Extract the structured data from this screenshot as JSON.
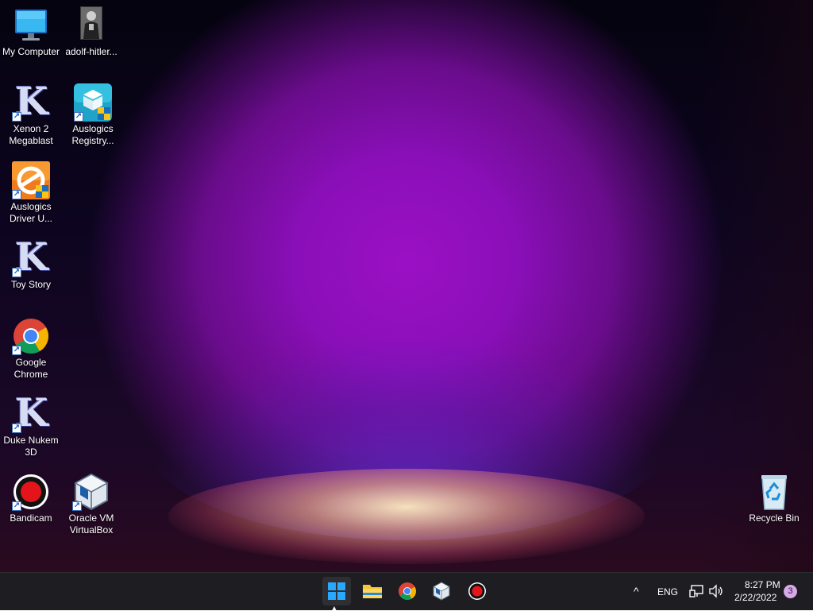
{
  "desktop": {
    "icons": [
      {
        "label": "My Computer"
      },
      {
        "label": "adolf-hitler..."
      },
      {
        "label": "Xenon 2 Megablast"
      },
      {
        "label": "Auslogics Registry..."
      },
      {
        "label": "Auslogics Driver U..."
      },
      {
        "label": "Toy Story"
      },
      {
        "label": "Google Chrome"
      },
      {
        "label": "Duke Nukem 3D"
      },
      {
        "label": "Bandicam"
      },
      {
        "label": "Oracle VM VirtualBox"
      },
      {
        "label": "Recycle Bin"
      }
    ]
  },
  "taskbar": {
    "pinned": [
      {
        "icon": "windows-start-icon"
      },
      {
        "icon": "file-explorer-icon"
      },
      {
        "icon": "chrome-icon"
      },
      {
        "icon": "virtualbox-icon"
      },
      {
        "icon": "bandicam-icon"
      }
    ],
    "tray": {
      "chevron": "^",
      "language": "ENG",
      "time": "8:27 PM",
      "date": "2/22/2022",
      "notifications": "3"
    }
  },
  "colors": {
    "taskbar_bg": "#1d1d22",
    "accent_purple": "#9b10c4",
    "windows_blue": "#29a8ff"
  }
}
